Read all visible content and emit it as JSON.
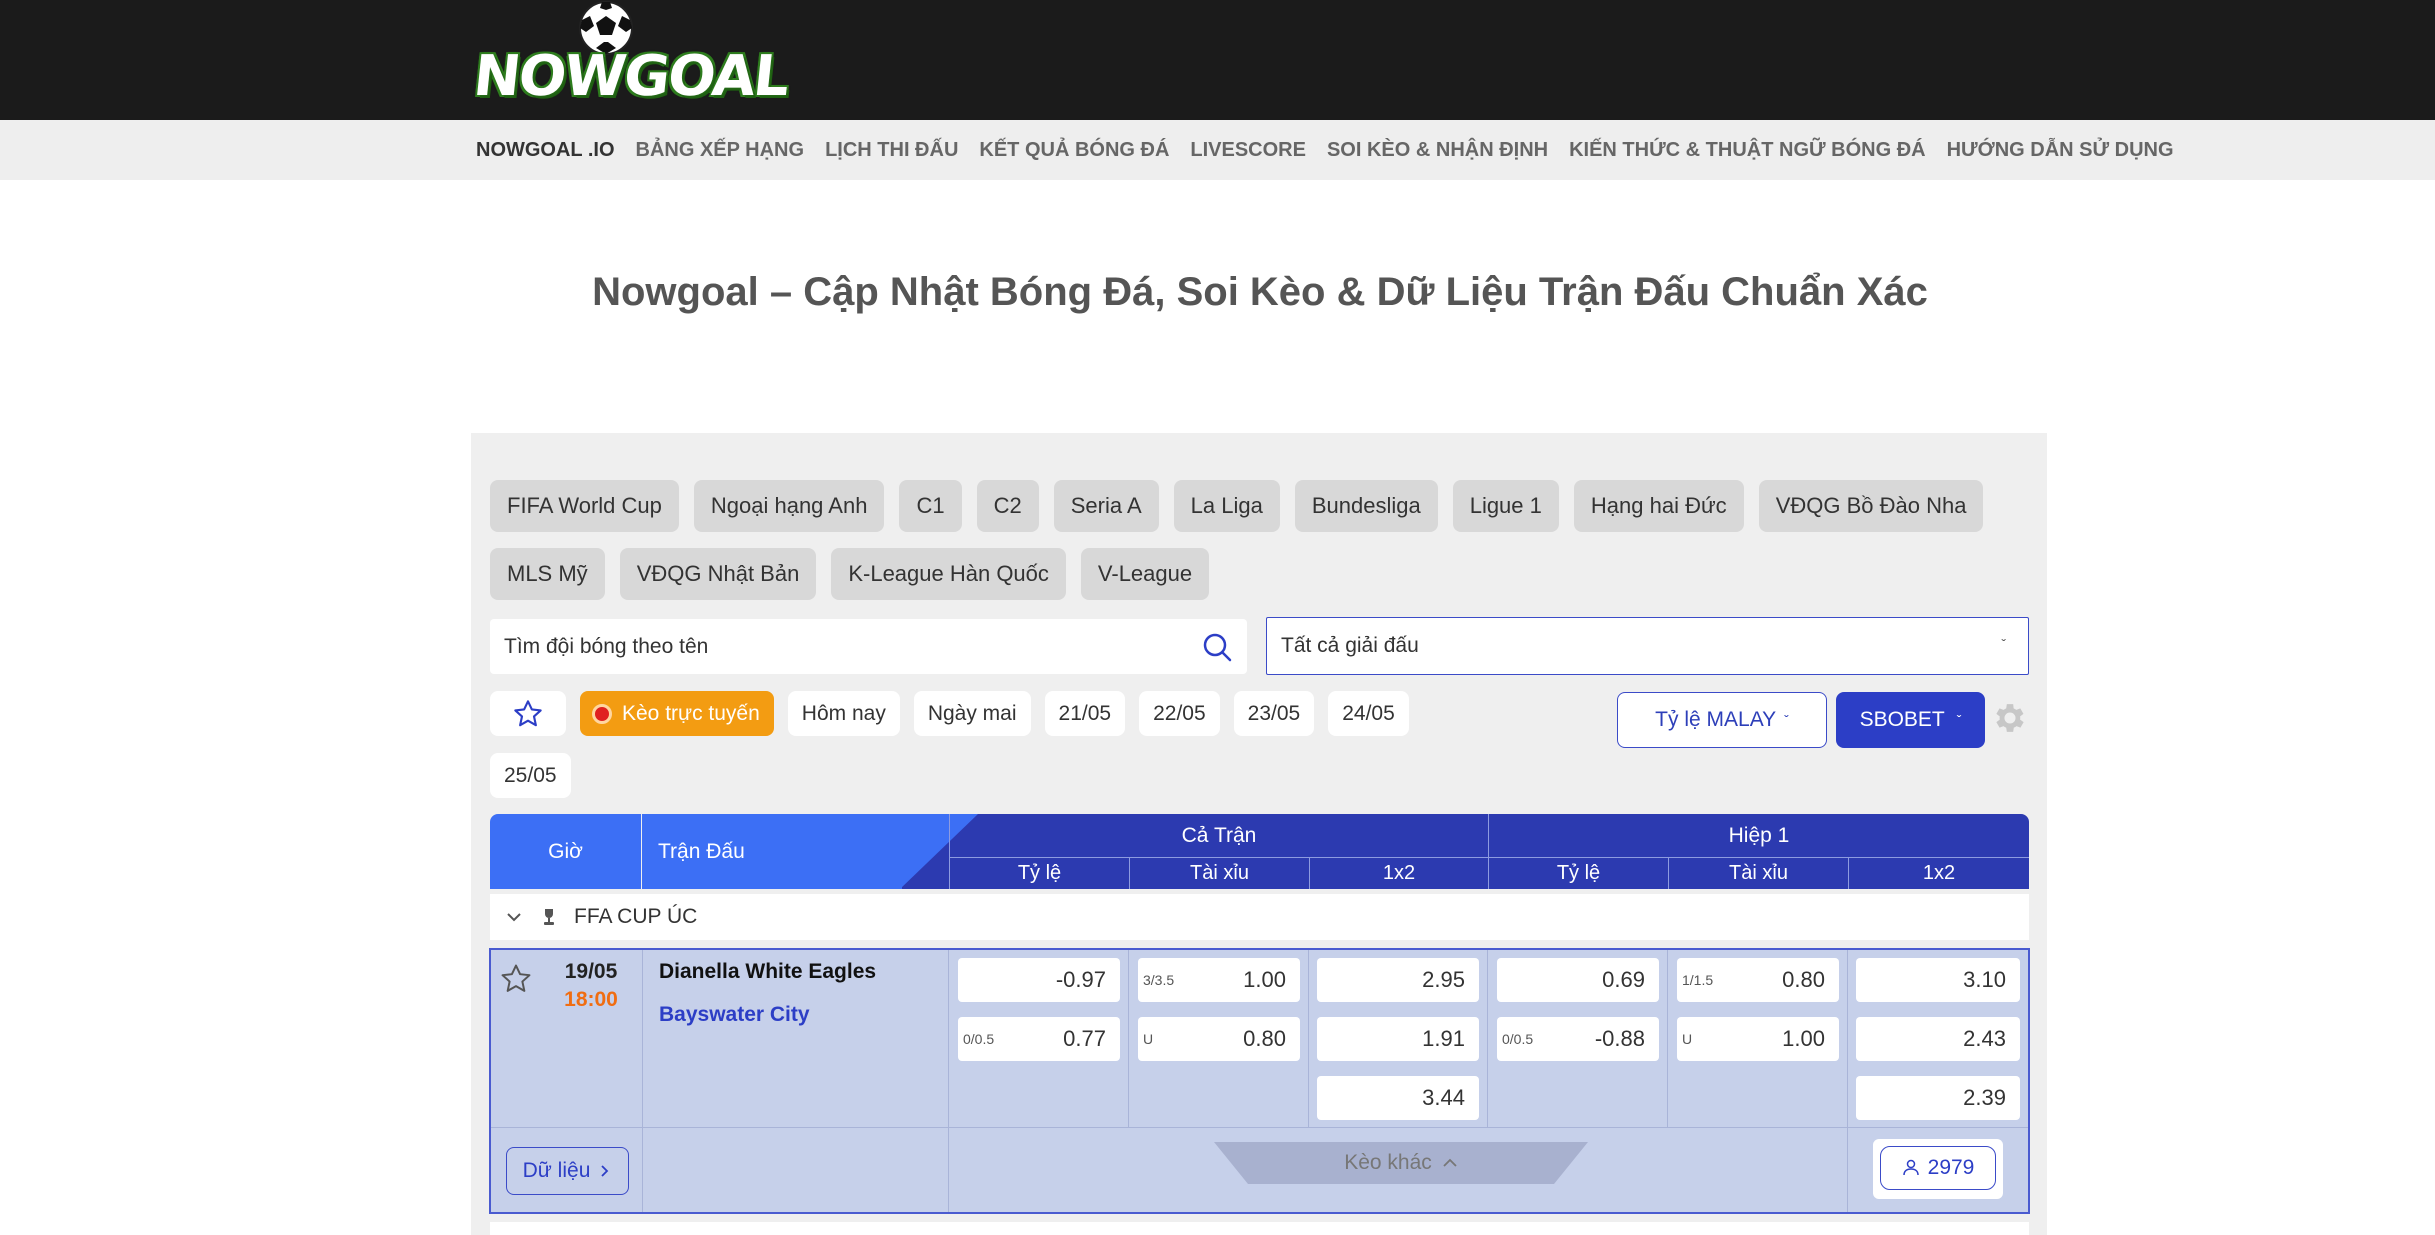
{
  "header": {
    "logo_text": "NOWGOAL"
  },
  "nav": {
    "items": [
      "NOWGOAL .IO",
      "BẢNG XẾP HẠNG",
      "LỊCH THI ĐẤU",
      "KẾT QUẢ BÓNG ĐÁ",
      "LIVESCORE",
      "SOI KÈO & NHẬN ĐỊNH",
      "KIẾN THỨC & THUẬT NGỮ BÓNG ĐÁ",
      "HƯỚNG DẪN SỬ DỤNG"
    ]
  },
  "page_title": "Nowgoal – Cập Nhật Bóng Đá, Soi Kèo & Dữ Liệu Trận Đấu Chuẩn Xác",
  "leagues": [
    "FIFA World Cup",
    "Ngoại hạng Anh",
    "C1",
    "C2",
    "Seria A",
    "La Liga",
    "Bundesliga",
    "Ligue 1",
    "Hạng hai Đức",
    "VĐQG Bồ Đào Nha",
    "MLS Mỹ",
    "VĐQG Nhật Bản",
    "K-League Hàn Quốc",
    "V-League"
  ],
  "search": {
    "placeholder": "Tìm đội bóng theo tên"
  },
  "league_select": {
    "value": "Tất cả giải đấu",
    "chevron": "ˇ"
  },
  "filters": {
    "live_label": "Kèo trực tuyến",
    "today": "Hôm nay",
    "tomorrow": "Ngày mai",
    "dates": [
      "21/05",
      "22/05",
      "23/05",
      "24/05"
    ],
    "date_extra": "25/05"
  },
  "odds_type": {
    "label": "Tỷ lệ MALAY",
    "chevron": "ˇ"
  },
  "bookmaker": {
    "label": "SBOBET",
    "chevron": "ˇ"
  },
  "table": {
    "col_time": "Giờ",
    "col_match": "Trận Đấu",
    "group_full": "Cả Trận",
    "group_half": "Hiệp 1",
    "sub_handicap": "Tỷ lệ",
    "sub_ou": "Tài xỉu",
    "sub_1x2": "1x2"
  },
  "league_group": {
    "name": "FFA CUP ÚC"
  },
  "match": {
    "date": "19/05",
    "time": "18:00",
    "home": "Dianella White Eagles",
    "away": "Bayswater City",
    "full": {
      "handicap": {
        "top_line": "",
        "top": "-0.97",
        "bottom_line": "0/0.5",
        "bottom": "0.77"
      },
      "ou": {
        "top_line": "3/3.5",
        "top": "1.00",
        "bottom_line": "U",
        "bottom": "0.80"
      },
      "x12": [
        "2.95",
        "1.91",
        "3.44"
      ]
    },
    "half": {
      "handicap": {
        "top_line": "",
        "top": "0.69",
        "bottom_line": "0/0.5",
        "bottom": "-0.88"
      },
      "ou": {
        "top_line": "1/1.5",
        "top": "0.80",
        "bottom_line": "U",
        "bottom": "1.00"
      },
      "x12": [
        "3.10",
        "2.43",
        "2.39"
      ]
    },
    "data_button": "Dữ liệu",
    "more_odds": "Kèo khác",
    "views": "2979"
  },
  "colors": {
    "header_bg": "#1b1b1b",
    "table_header": "#2c3ab0",
    "table_header_light": "#3c6ff5",
    "match_row_bg": "#c6d0ea",
    "accent_orange": "#f39c12",
    "time_orange": "#f06d12",
    "brand_blue": "#2c3ec6"
  }
}
